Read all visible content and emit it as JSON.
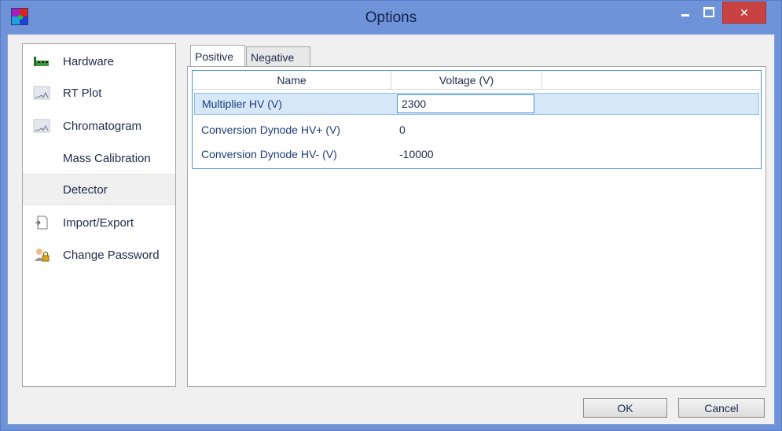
{
  "window": {
    "title": "Options",
    "close_glyph": "✕"
  },
  "sidebar": {
    "items": [
      {
        "label": "Hardware",
        "icon": "hardware-board-icon"
      },
      {
        "label": "RT Plot",
        "icon": "plot-icon"
      },
      {
        "label": "Chromatogram",
        "icon": "chromatogram-icon"
      },
      {
        "label": "Mass Calibration",
        "icon": ""
      },
      {
        "label": "Detector",
        "icon": "",
        "selected": true
      },
      {
        "label": "Import/Export",
        "icon": "import-export-icon"
      },
      {
        "label": "Change Password",
        "icon": "user-lock-icon"
      }
    ]
  },
  "tabs": [
    {
      "label": "Positive",
      "active": true
    },
    {
      "label": "Negative",
      "active": false
    }
  ],
  "table": {
    "columns": [
      "Name",
      "Voltage (V)"
    ],
    "rows": [
      {
        "name": "Multiplier HV (V)",
        "value": "2300",
        "editing": true
      },
      {
        "name": "Conversion Dynode HV+ (V)",
        "value": "0"
      },
      {
        "name": "Conversion Dynode HV- (V)",
        "value": "-10000"
      }
    ]
  },
  "buttons": {
    "ok": "OK",
    "cancel": "Cancel"
  },
  "colors": {
    "title_bar": "#6f93d9",
    "close_button": "#c94242",
    "selection": "#d6e8f8",
    "accent_border": "#4d94d8"
  }
}
